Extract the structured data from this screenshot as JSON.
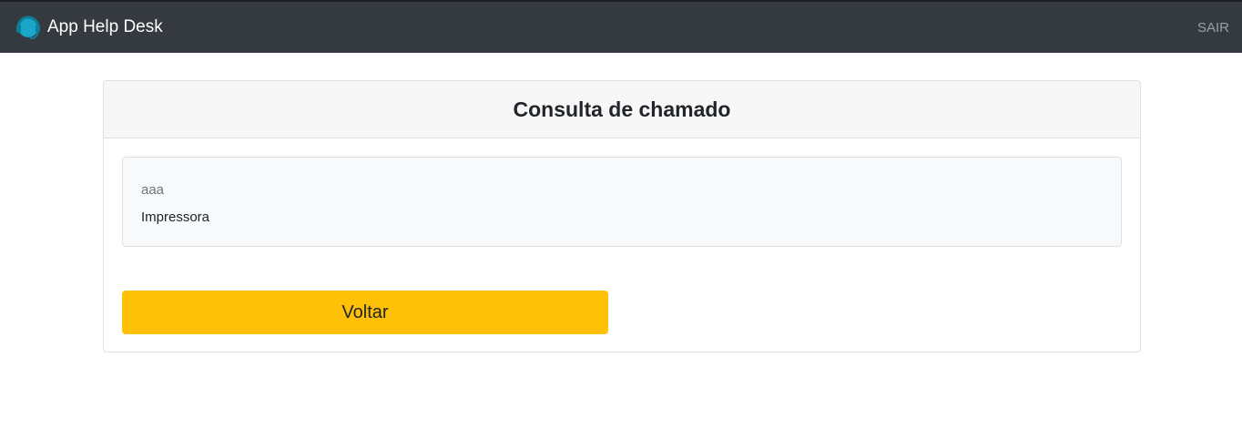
{
  "navbar": {
    "brand_icon": "headset-icon",
    "brand_name": "App Help Desk",
    "logout_label": "SAIR",
    "accent_color": "#1aa6c9"
  },
  "card": {
    "title": "Consulta de chamado",
    "ticket": {
      "title": "aaa",
      "category": "Impressora"
    },
    "back_label": "Voltar",
    "button_color": "#ffc107"
  }
}
